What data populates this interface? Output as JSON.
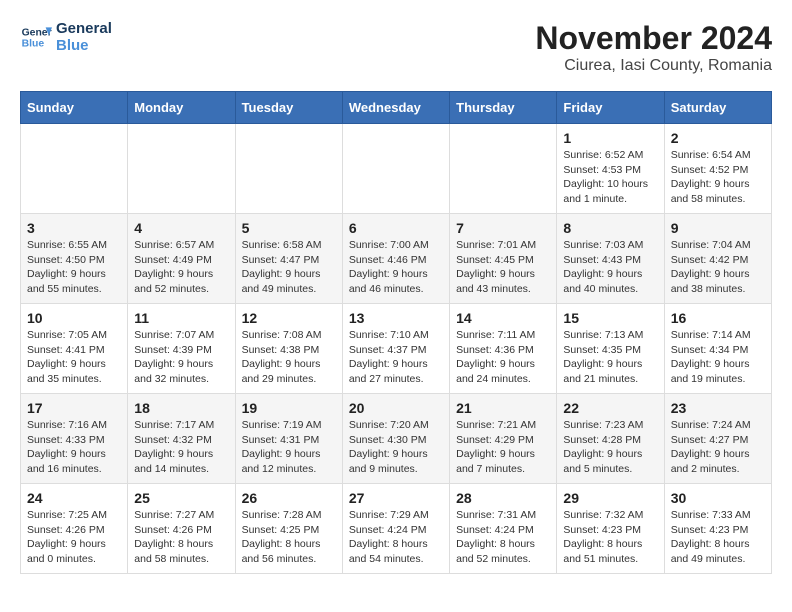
{
  "logo": {
    "line1": "General",
    "line2": "Blue"
  },
  "title": "November 2024",
  "subtitle": "Ciurea, Iasi County, Romania",
  "header": {
    "days": [
      "Sunday",
      "Monday",
      "Tuesday",
      "Wednesday",
      "Thursday",
      "Friday",
      "Saturday"
    ]
  },
  "weeks": [
    {
      "cells": [
        {
          "day": "",
          "info": ""
        },
        {
          "day": "",
          "info": ""
        },
        {
          "day": "",
          "info": ""
        },
        {
          "day": "",
          "info": ""
        },
        {
          "day": "",
          "info": ""
        },
        {
          "day": "1",
          "info": "Sunrise: 6:52 AM\nSunset: 4:53 PM\nDaylight: 10 hours\nand 1 minute."
        },
        {
          "day": "2",
          "info": "Sunrise: 6:54 AM\nSunset: 4:52 PM\nDaylight: 9 hours\nand 58 minutes."
        }
      ]
    },
    {
      "cells": [
        {
          "day": "3",
          "info": "Sunrise: 6:55 AM\nSunset: 4:50 PM\nDaylight: 9 hours\nand 55 minutes."
        },
        {
          "day": "4",
          "info": "Sunrise: 6:57 AM\nSunset: 4:49 PM\nDaylight: 9 hours\nand 52 minutes."
        },
        {
          "day": "5",
          "info": "Sunrise: 6:58 AM\nSunset: 4:47 PM\nDaylight: 9 hours\nand 49 minutes."
        },
        {
          "day": "6",
          "info": "Sunrise: 7:00 AM\nSunset: 4:46 PM\nDaylight: 9 hours\nand 46 minutes."
        },
        {
          "day": "7",
          "info": "Sunrise: 7:01 AM\nSunset: 4:45 PM\nDaylight: 9 hours\nand 43 minutes."
        },
        {
          "day": "8",
          "info": "Sunrise: 7:03 AM\nSunset: 4:43 PM\nDaylight: 9 hours\nand 40 minutes."
        },
        {
          "day": "9",
          "info": "Sunrise: 7:04 AM\nSunset: 4:42 PM\nDaylight: 9 hours\nand 38 minutes."
        }
      ]
    },
    {
      "cells": [
        {
          "day": "10",
          "info": "Sunrise: 7:05 AM\nSunset: 4:41 PM\nDaylight: 9 hours\nand 35 minutes."
        },
        {
          "day": "11",
          "info": "Sunrise: 7:07 AM\nSunset: 4:39 PM\nDaylight: 9 hours\nand 32 minutes."
        },
        {
          "day": "12",
          "info": "Sunrise: 7:08 AM\nSunset: 4:38 PM\nDaylight: 9 hours\nand 29 minutes."
        },
        {
          "day": "13",
          "info": "Sunrise: 7:10 AM\nSunset: 4:37 PM\nDaylight: 9 hours\nand 27 minutes."
        },
        {
          "day": "14",
          "info": "Sunrise: 7:11 AM\nSunset: 4:36 PM\nDaylight: 9 hours\nand 24 minutes."
        },
        {
          "day": "15",
          "info": "Sunrise: 7:13 AM\nSunset: 4:35 PM\nDaylight: 9 hours\nand 21 minutes."
        },
        {
          "day": "16",
          "info": "Sunrise: 7:14 AM\nSunset: 4:34 PM\nDaylight: 9 hours\nand 19 minutes."
        }
      ]
    },
    {
      "cells": [
        {
          "day": "17",
          "info": "Sunrise: 7:16 AM\nSunset: 4:33 PM\nDaylight: 9 hours\nand 16 minutes."
        },
        {
          "day": "18",
          "info": "Sunrise: 7:17 AM\nSunset: 4:32 PM\nDaylight: 9 hours\nand 14 minutes."
        },
        {
          "day": "19",
          "info": "Sunrise: 7:19 AM\nSunset: 4:31 PM\nDaylight: 9 hours\nand 12 minutes."
        },
        {
          "day": "20",
          "info": "Sunrise: 7:20 AM\nSunset: 4:30 PM\nDaylight: 9 hours\nand 9 minutes."
        },
        {
          "day": "21",
          "info": "Sunrise: 7:21 AM\nSunset: 4:29 PM\nDaylight: 9 hours\nand 7 minutes."
        },
        {
          "day": "22",
          "info": "Sunrise: 7:23 AM\nSunset: 4:28 PM\nDaylight: 9 hours\nand 5 minutes."
        },
        {
          "day": "23",
          "info": "Sunrise: 7:24 AM\nSunset: 4:27 PM\nDaylight: 9 hours\nand 2 minutes."
        }
      ]
    },
    {
      "cells": [
        {
          "day": "24",
          "info": "Sunrise: 7:25 AM\nSunset: 4:26 PM\nDaylight: 9 hours\nand 0 minutes."
        },
        {
          "day": "25",
          "info": "Sunrise: 7:27 AM\nSunset: 4:26 PM\nDaylight: 8 hours\nand 58 minutes."
        },
        {
          "day": "26",
          "info": "Sunrise: 7:28 AM\nSunset: 4:25 PM\nDaylight: 8 hours\nand 56 minutes."
        },
        {
          "day": "27",
          "info": "Sunrise: 7:29 AM\nSunset: 4:24 PM\nDaylight: 8 hours\nand 54 minutes."
        },
        {
          "day": "28",
          "info": "Sunrise: 7:31 AM\nSunset: 4:24 PM\nDaylight: 8 hours\nand 52 minutes."
        },
        {
          "day": "29",
          "info": "Sunrise: 7:32 AM\nSunset: 4:23 PM\nDaylight: 8 hours\nand 51 minutes."
        },
        {
          "day": "30",
          "info": "Sunrise: 7:33 AM\nSunset: 4:23 PM\nDaylight: 8 hours\nand 49 minutes."
        }
      ]
    }
  ]
}
